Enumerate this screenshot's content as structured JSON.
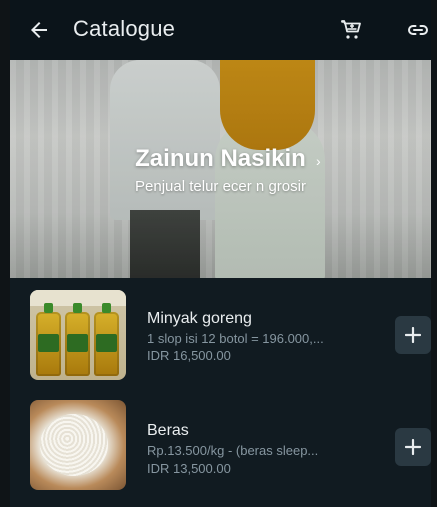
{
  "appbar": {
    "title": "Catalogue",
    "icons": {
      "back": "arrow-back-icon",
      "cart": "cart-icon",
      "link": "link-icon"
    }
  },
  "store": {
    "name": "Zainun Nasikin",
    "description": "Penjual telur ecer n grosir"
  },
  "products": [
    {
      "name": "Minyak goreng",
      "description": "1 slop isi 12 botol = 196.000,...",
      "price": "IDR 16,500.00",
      "image_icon": "cooking-oil-bottles-image"
    },
    {
      "name": "Beras",
      "description": "Rp.13.500/kg - (beras sleep...",
      "price": "IDR 13,500.00",
      "image_icon": "rice-bowl-image"
    }
  ],
  "colors": {
    "background": "#111b21",
    "appbar": "#0b141a",
    "text_primary": "#e9edef",
    "text_secondary": "#8696a0",
    "button": "#2a3942"
  }
}
